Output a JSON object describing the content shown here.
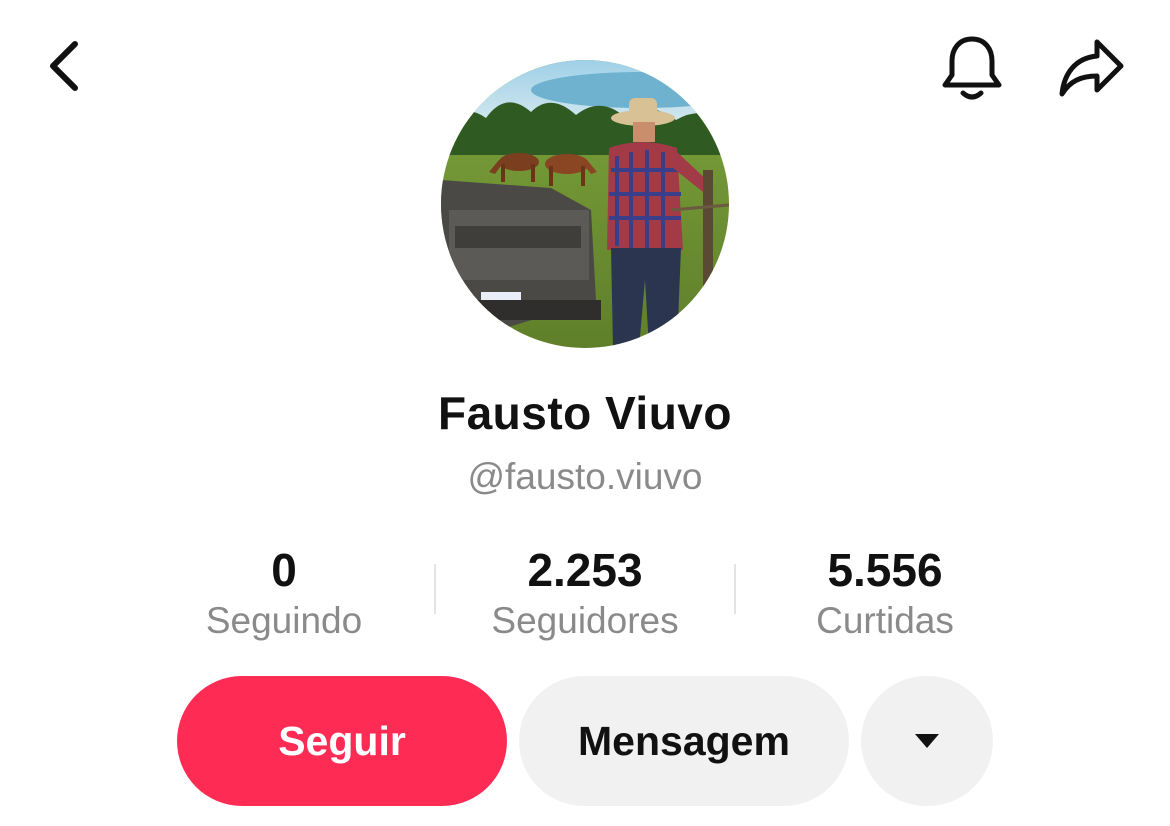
{
  "header": {
    "back_icon": "chevron-left-icon",
    "notification_icon": "bell-icon",
    "share_icon": "share-arrow-icon"
  },
  "profile": {
    "avatar_description": "profile-photo",
    "display_name": "Fausto Viuvo",
    "username": "@fausto.viuvo"
  },
  "stats": {
    "following": {
      "value": "0",
      "label": "Seguindo"
    },
    "followers": {
      "value": "2.253",
      "label": "Seguidores"
    },
    "likes": {
      "value": "5.556",
      "label": "Curtidas"
    }
  },
  "actions": {
    "follow_label": "Seguir",
    "message_label": "Mensagem",
    "more_icon": "caret-down-icon"
  },
  "colors": {
    "follow_button": "#fe2c55",
    "secondary_button": "#f1f1f2",
    "muted_text": "#8a8a8a"
  }
}
